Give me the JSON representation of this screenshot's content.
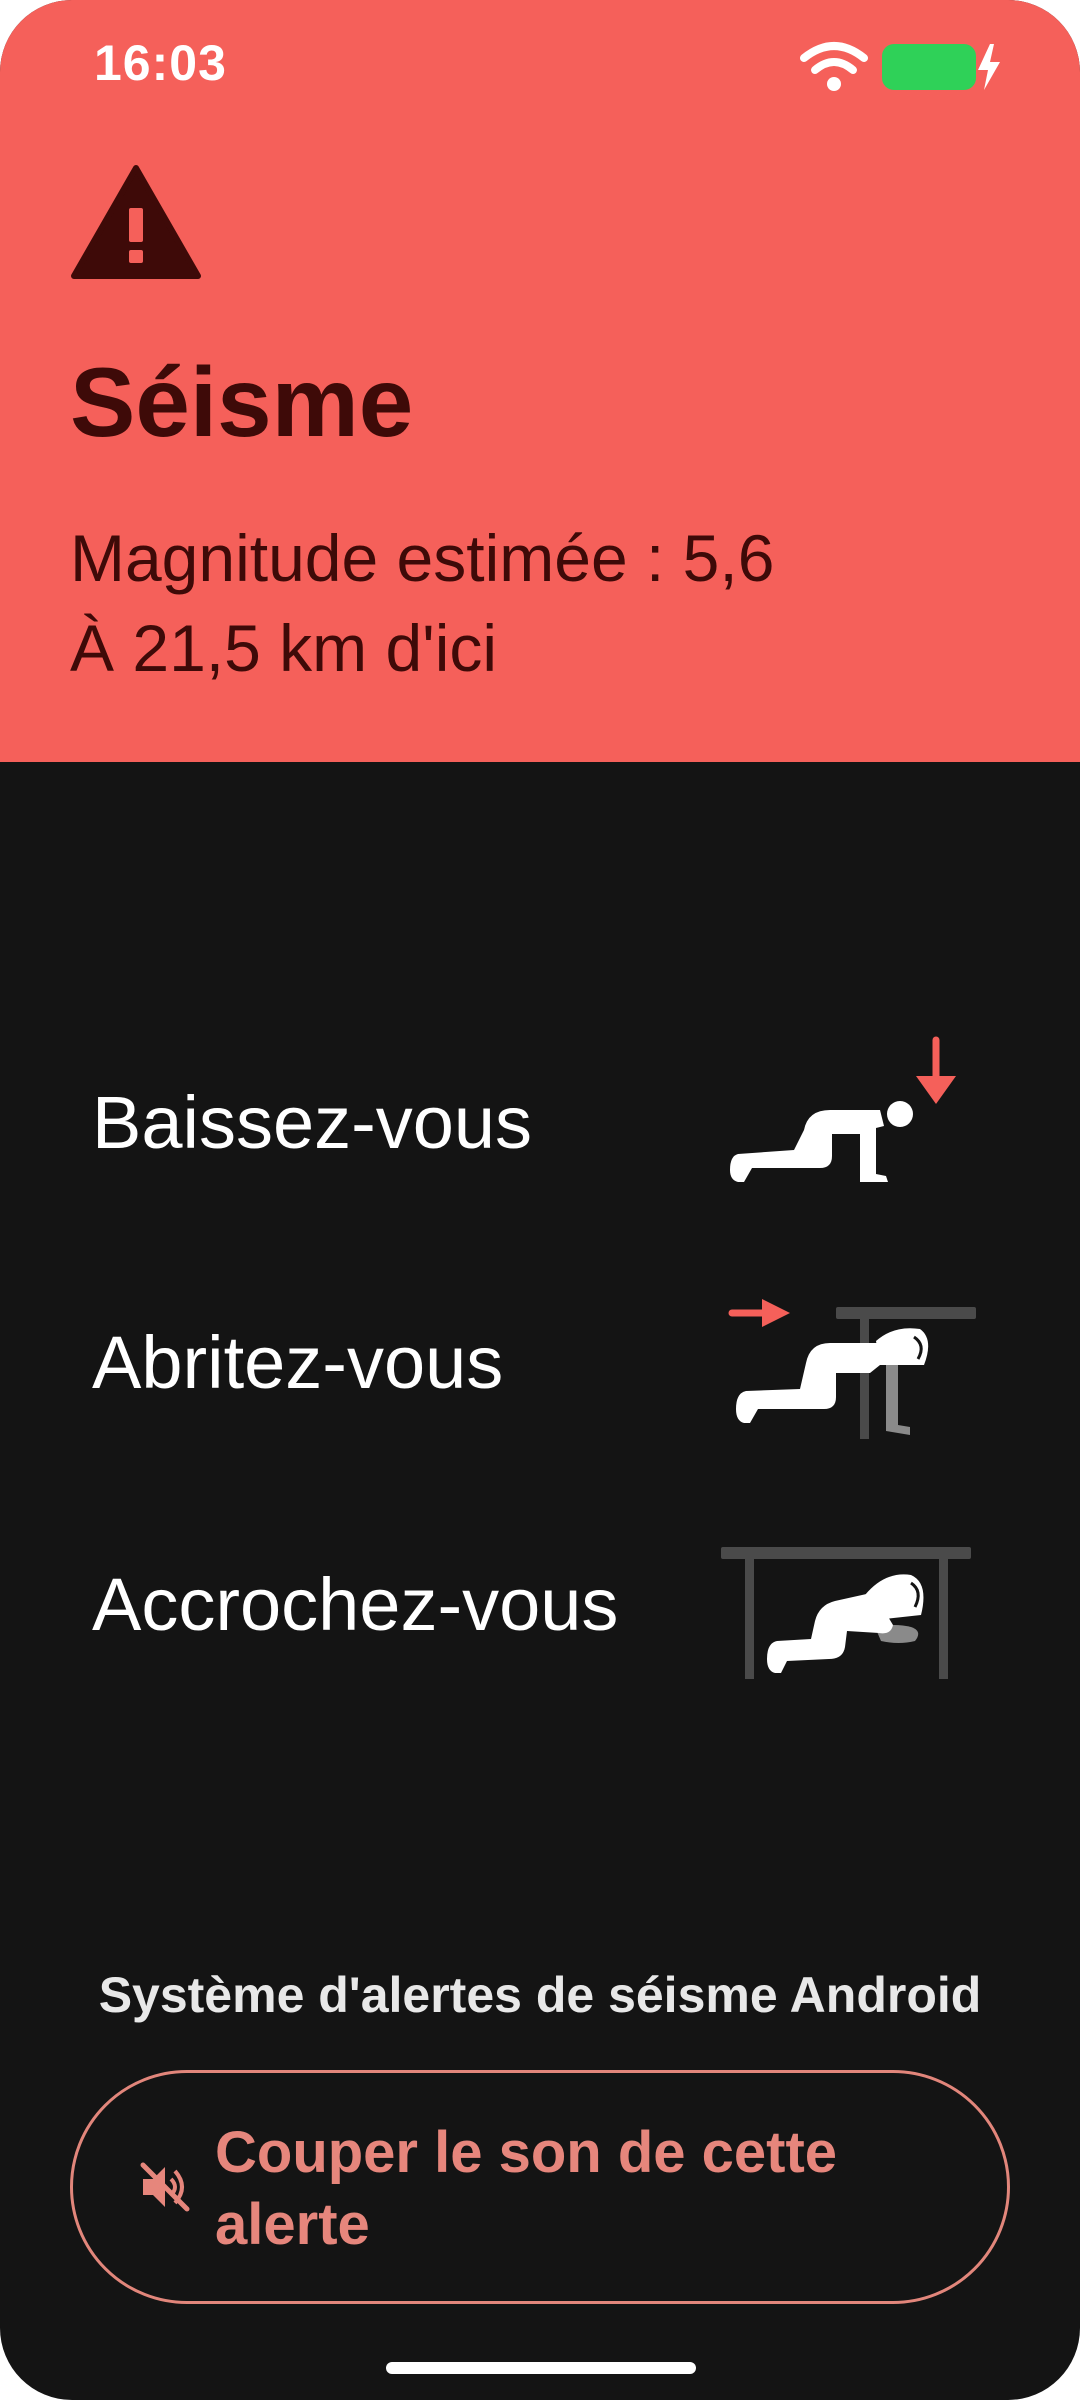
{
  "status_bar": {
    "time": "16:03"
  },
  "alert": {
    "title": "Séisme",
    "magnitude": "Magnitude estimée : 5,6",
    "distance": "À 21,5 km d'ici"
  },
  "instructions": [
    {
      "label": "Baissez-vous",
      "icon": "drop-figure-icon"
    },
    {
      "label": "Abritez-vous",
      "icon": "cover-figure-icon"
    },
    {
      "label": "Accrochez-vous",
      "icon": "hold-on-figure-icon"
    }
  ],
  "footer": {
    "system_label": "Système d'alertes de séisme Android",
    "mute_button_label": "Couper le son de cette alerte"
  },
  "colors": {
    "header_bg": "#f5605a",
    "body_bg": "#141414",
    "header_text": "#3e0a08",
    "accent": "#e6867c",
    "arrow": "#f5605a"
  }
}
